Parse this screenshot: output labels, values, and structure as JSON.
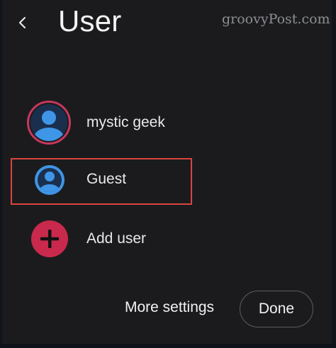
{
  "header": {
    "title": "User",
    "back_icon": "chevron-left-icon"
  },
  "watermark": "groovyPost.com",
  "users": [
    {
      "label": "mystic geek",
      "icon": "account-circle-icon",
      "active": true
    },
    {
      "label": "Guest",
      "icon": "account-circle-icon",
      "highlighted": true
    },
    {
      "label": "Add user",
      "icon": "add-circle-icon"
    }
  ],
  "footer": {
    "more_settings_label": "More settings",
    "done_label": "Done"
  },
  "colors": {
    "background": "#1b1b1d",
    "avatar_blue": "#3f95e6",
    "avatar_dark": "#1a2f4d",
    "active_ring": "#c8375c",
    "add_red": "#c8294c",
    "highlight_border": "#d8453f"
  }
}
